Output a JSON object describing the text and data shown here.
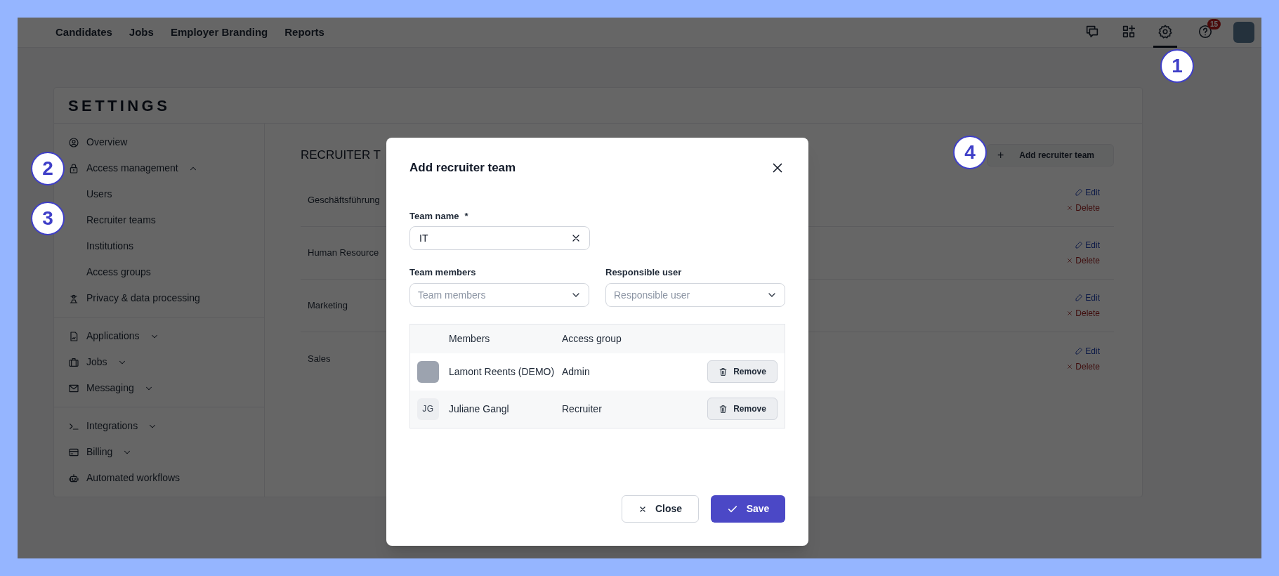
{
  "top_nav": {
    "links": [
      {
        "label": "Candidates"
      },
      {
        "label": "Jobs"
      },
      {
        "label": "Employer Branding"
      },
      {
        "label": "Reports"
      }
    ],
    "icons": [
      {
        "selected": false
      },
      {
        "selected": false
      },
      {
        "selected": true
      },
      {
        "selected": false,
        "badge": "15"
      }
    ]
  },
  "settings": {
    "title": "SETTINGS",
    "sidebar": {
      "groups": [
        [
          {
            "kind": "link",
            "label": "Overview"
          },
          {
            "kind": "menu",
            "label": "Access management",
            "expanded": true,
            "children": [
              {
                "label": "Users"
              },
              {
                "label": "Recruiter teams"
              },
              {
                "label": "Institutions"
              },
              {
                "label": "Access groups"
              }
            ]
          },
          {
            "kind": "link",
            "label": "Privacy & data processing"
          }
        ],
        [
          {
            "kind": "menu",
            "label": "Applications",
            "expanded": false
          },
          {
            "kind": "menu",
            "label": "Jobs",
            "expanded": false
          },
          {
            "kind": "menu",
            "label": "Messaging",
            "expanded": false
          }
        ],
        [
          {
            "kind": "menu",
            "label": "Integrations",
            "expanded": false
          },
          {
            "kind": "menu",
            "label": "Billing",
            "expanded": false
          },
          {
            "kind": "link",
            "label": "Automated workflows"
          }
        ]
      ]
    },
    "page_title": "RECRUITER T",
    "add_button": {
      "icon_text": "+",
      "label": "Add recruiter team"
    },
    "teams": [
      {
        "name": "Geschäftsführung",
        "edit": "Edit",
        "delete": "Delete"
      },
      {
        "name": "Human Resource",
        "edit": "Edit",
        "delete": "Delete"
      },
      {
        "name": "Marketing",
        "edit": "Edit",
        "delete": "Delete"
      },
      {
        "name": "Sales",
        "edit": "Edit",
        "delete": "Delete"
      }
    ]
  },
  "modal": {
    "title": "Add recruiter team",
    "team_name": {
      "label": "Team name",
      "required": "*",
      "value": "IT"
    },
    "team_members": {
      "label": "Team members",
      "placeholder": "Team members"
    },
    "responsible_user": {
      "label": "Responsible user",
      "placeholder": "Responsible user"
    },
    "table": {
      "columns": [
        "Members",
        "Access group"
      ],
      "rows": [
        {
          "kind": "photo",
          "name": "Lamont Reents (DEMO)",
          "access_group": "Admin",
          "action": "Remove"
        },
        {
          "kind": "initials",
          "initials": "JG",
          "name": "Juliane Gangl",
          "access_group": "Recruiter",
          "action": "Remove"
        }
      ]
    },
    "buttons": {
      "close": "Close",
      "save": "Save"
    }
  },
  "callouts": [
    "1",
    "2",
    "3",
    "4"
  ]
}
